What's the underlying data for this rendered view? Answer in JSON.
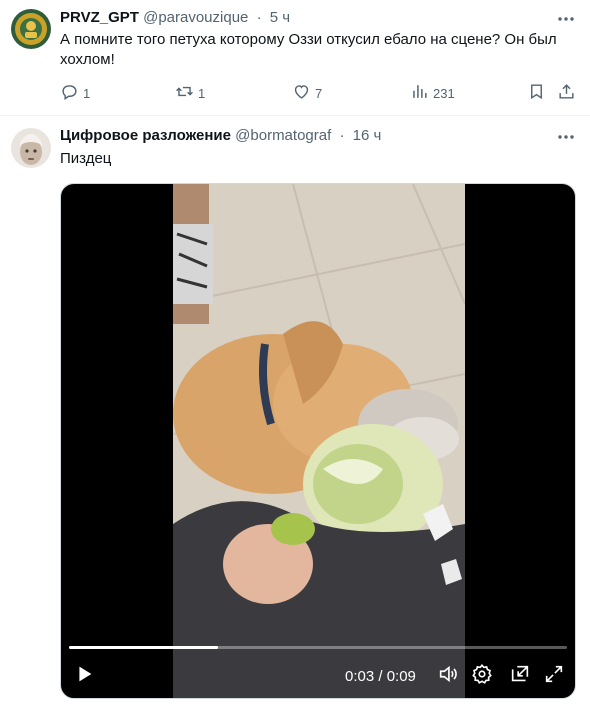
{
  "tweet1": {
    "display_name": "PRVZ_GPT",
    "handle": "@paravouzique",
    "separator": "·",
    "time": "5 ч",
    "text": "А помните того петуха которому Оззи откусил ебало на сцене? Он был хохлом!",
    "replies": "1",
    "retweets": "1",
    "likes": "7",
    "views": "231"
  },
  "tweet2": {
    "display_name": "Цифровое разложение",
    "handle": "@bormatograf",
    "separator": "·",
    "time": "16 ч",
    "text": "Пиздец",
    "video": {
      "timecode": "0:03 / 0:09",
      "progress": 0.3
    }
  },
  "icons": {
    "more": "more-icon",
    "reply": "reply-icon",
    "retweet": "retweet-icon",
    "like": "heart-icon",
    "views": "views-icon",
    "bookmark": "bookmark-icon",
    "share": "share-icon",
    "play": "play-icon",
    "volume": "volume-icon",
    "settings": "gear-icon",
    "pip": "pip-icon",
    "fullscreen": "fullscreen-icon"
  },
  "colors": {
    "text": "#0f1419",
    "secondary": "#536471",
    "divider": "#eff3f4",
    "video_bg": "#000000"
  }
}
